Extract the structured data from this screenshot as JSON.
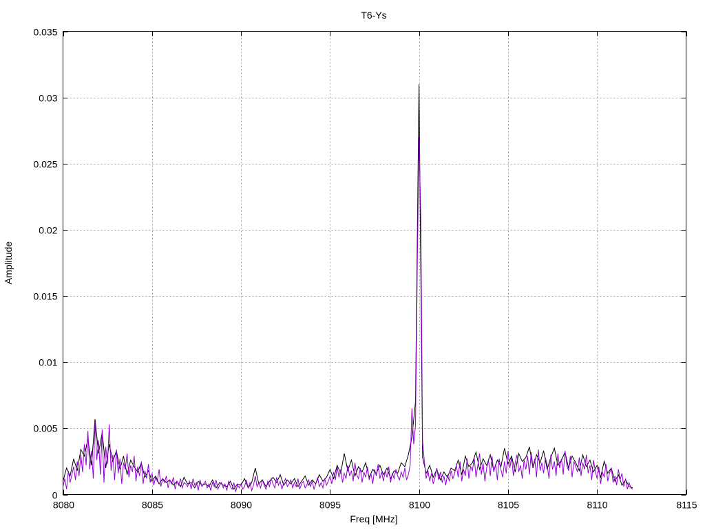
{
  "chart_data": {
    "type": "line",
    "title": "T6-Ys",
    "xlabel": "Freq [MHz]",
    "ylabel": "Amplitude",
    "xlim": [
      8080,
      8115
    ],
    "ylim": [
      0,
      0.035
    ],
    "xticks": [
      "8080",
      "8085",
      "8090",
      "8095",
      "8100",
      "8105",
      "8110",
      "8115"
    ],
    "xtick_values": [
      8080,
      8085,
      8090,
      8095,
      8100,
      8105,
      8110,
      8115
    ],
    "yticks": [
      "0",
      "0.005",
      "0.01",
      "0.015",
      "0.02",
      "0.025",
      "0.03",
      "0.035"
    ],
    "ytick_values": [
      0,
      0.005,
      0.01,
      0.015,
      0.02,
      0.025,
      0.03,
      0.035
    ],
    "grid": true,
    "legend": "none",
    "series": [
      {
        "name": "black",
        "color": "#000000",
        "x_start": 8080,
        "x_step": 0.2,
        "values": [
          0.001,
          0.002,
          0.0014,
          0.0027,
          0.0018,
          0.0034,
          0.0029,
          0.0042,
          0.0022,
          0.0057,
          0.0031,
          0.0047,
          0.002,
          0.0038,
          0.0025,
          0.0033,
          0.0019,
          0.0029,
          0.0015,
          0.0026,
          0.0021,
          0.0017,
          0.0024,
          0.0013,
          0.0018,
          0.001,
          0.0014,
          0.0008,
          0.0012,
          0.0009,
          0.0011,
          0.0007,
          0.001,
          0.0006,
          0.0013,
          0.0008,
          0.0009,
          0.0005,
          0.001,
          0.0007,
          0.0008,
          0.0006,
          0.0011,
          0.0005,
          0.0009,
          0.0007,
          0.0006,
          0.001,
          0.0004,
          0.0008,
          0.0007,
          0.0012,
          0.0005,
          0.0009,
          0.002,
          0.0008,
          0.0011,
          0.0006,
          0.001,
          0.0013,
          0.0009,
          0.0015,
          0.0007,
          0.0011,
          0.0008,
          0.0012,
          0.0006,
          0.001,
          0.0014,
          0.0007,
          0.0011,
          0.0008,
          0.0015,
          0.001,
          0.0013,
          0.0019,
          0.0012,
          0.0022,
          0.0016,
          0.0031,
          0.0018,
          0.0026,
          0.0014,
          0.0021,
          0.0017,
          0.0024,
          0.0013,
          0.0019,
          0.0016,
          0.0022,
          0.0015,
          0.002,
          0.0012,
          0.0018,
          0.0016,
          0.0024,
          0.0021,
          0.003,
          0.0043,
          0.007,
          0.031,
          0.0028,
          0.0016,
          0.0022,
          0.0013,
          0.0019,
          0.0011,
          0.0017,
          0.0013,
          0.002,
          0.0018,
          0.0026,
          0.0015,
          0.0029,
          0.0021,
          0.0024,
          0.0032,
          0.0019,
          0.0027,
          0.0022,
          0.003,
          0.0018,
          0.0026,
          0.0021,
          0.0035,
          0.0023,
          0.0029,
          0.0017,
          0.0031,
          0.0025,
          0.0028,
          0.0036,
          0.002,
          0.003,
          0.0024,
          0.0033,
          0.0019,
          0.0028,
          0.0035,
          0.0022,
          0.0026,
          0.0032,
          0.002,
          0.0029,
          0.0024,
          0.0018,
          0.003,
          0.0021,
          0.0026,
          0.0017,
          0.0022,
          0.0013,
          0.0025,
          0.0016,
          0.002,
          0.001,
          0.0015,
          0.0007,
          0.0011,
          0.0006,
          0.0005
        ]
      },
      {
        "name": "purple",
        "color": "#9400d3",
        "x_start": 8080,
        "x_step": 0.1,
        "values": [
          0.0006,
          0.0012,
          0.0004,
          0.0018,
          0.0009,
          0.0015,
          0.0021,
          0.0011,
          0.0025,
          0.0014,
          0.003,
          0.0017,
          0.0038,
          0.0022,
          0.0048,
          0.0019,
          0.0033,
          0.0012,
          0.0055,
          0.0026,
          0.0041,
          0.0015,
          0.0049,
          0.0009,
          0.0036,
          0.0023,
          0.0053,
          0.0018,
          0.003,
          0.0011,
          0.0034,
          0.0016,
          0.0027,
          0.0008,
          0.0024,
          0.0019,
          0.0031,
          0.0013,
          0.0022,
          0.0017,
          0.0029,
          0.001,
          0.0021,
          0.0014,
          0.0025,
          0.0008,
          0.0018,
          0.0012,
          0.0023,
          0.0009,
          0.0016,
          0.0007,
          0.0013,
          0.001,
          0.0019,
          0.0006,
          0.0012,
          0.0009,
          0.0014,
          0.0005,
          0.0011,
          0.0008,
          0.0013,
          0.0004,
          0.001,
          0.0007,
          0.0012,
          0.0005,
          0.0009,
          0.0008,
          0.0006,
          0.001,
          0.0004,
          0.0012,
          0.0007,
          0.0009,
          0.0003,
          0.0011,
          0.0006,
          0.0008,
          0.001,
          0.0005,
          0.0008,
          0.0003,
          0.0009,
          0.0006,
          0.0011,
          0.0004,
          0.0007,
          0.0009,
          0.0005,
          0.0008,
          0.0003,
          0.001,
          0.0006,
          0.0004,
          0.0009,
          0.0002,
          0.0007,
          0.0005,
          0.0008,
          0.0004,
          0.0006,
          0.0011,
          0.0005,
          0.0009,
          0.0003,
          0.0007,
          0.0014,
          0.0006,
          0.0009,
          0.0005,
          0.0011,
          0.0007,
          0.0004,
          0.001,
          0.0006,
          0.0012,
          0.0008,
          0.0005,
          0.0013,
          0.0007,
          0.001,
          0.0004,
          0.0009,
          0.0012,
          0.0006,
          0.0008,
          0.0011,
          0.0005,
          0.0009,
          0.0006,
          0.0012,
          0.0004,
          0.0008,
          0.001,
          0.0005,
          0.0007,
          0.0011,
          0.0006,
          0.001,
          0.0004,
          0.0008,
          0.0013,
          0.0006,
          0.0009,
          0.0005,
          0.0012,
          0.0007,
          0.001,
          0.0014,
          0.0008,
          0.0017,
          0.0011,
          0.0021,
          0.0013,
          0.0019,
          0.0009,
          0.0016,
          0.0012,
          0.0022,
          0.0014,
          0.0018,
          0.001,
          0.0024,
          0.0015,
          0.0012,
          0.002,
          0.0009,
          0.0017,
          0.0013,
          0.0021,
          0.0011,
          0.0016,
          0.0008,
          0.0019,
          0.0014,
          0.0023,
          0.0012,
          0.0017,
          0.001,
          0.0018,
          0.0013,
          0.0021,
          0.0009,
          0.0016,
          0.0012,
          0.0019,
          0.0014,
          0.0011,
          0.0017,
          0.0013,
          0.002,
          0.0011,
          0.0015,
          0.0022,
          0.0065,
          0.0038,
          0.0052,
          0.017,
          0.027,
          0.021,
          0.004,
          0.0025,
          0.0012,
          0.0018,
          0.001,
          0.0016,
          0.0008,
          0.0013,
          0.002,
          0.0011,
          0.0017,
          0.0009,
          0.0014,
          0.0007,
          0.0015,
          0.001,
          0.0018,
          0.0012,
          0.0016,
          0.0022,
          0.0013,
          0.0025,
          0.001,
          0.0019,
          0.0014,
          0.0027,
          0.0012,
          0.0021,
          0.0018,
          0.0028,
          0.0013,
          0.0022,
          0.0031,
          0.0015,
          0.0024,
          0.001,
          0.002,
          0.0026,
          0.0014,
          0.0029,
          0.0017,
          0.0023,
          0.0011,
          0.0027,
          0.0019,
          0.0013,
          0.0025,
          0.0016,
          0.0033,
          0.002,
          0.0028,
          0.0014,
          0.0024,
          0.003,
          0.0017,
          0.0022,
          0.0012,
          0.0026,
          0.0019,
          0.0029,
          0.0015,
          0.0032,
          0.0021,
          0.0027,
          0.0013,
          0.0034,
          0.0018,
          0.0024,
          0.0016,
          0.0028,
          0.0022,
          0.0012,
          0.003,
          0.0019,
          0.0025,
          0.0014,
          0.0031,
          0.002,
          0.0027,
          0.0015,
          0.0033,
          0.0022,
          0.0018,
          0.0029,
          0.0013,
          0.0025,
          0.0021,
          0.0017,
          0.0028,
          0.0014,
          0.0024,
          0.0019,
          0.003,
          0.0016,
          0.0022,
          0.0011,
          0.0026,
          0.0018,
          0.0012,
          0.0021,
          0.0008,
          0.0017,
          0.0013,
          0.0023,
          0.001,
          0.0016,
          0.002,
          0.0009,
          0.0014,
          0.0007,
          0.0019,
          0.0011,
          0.0016,
          0.0006,
          0.0012,
          0.0004,
          0.0009,
          0.0005,
          0.0004
        ]
      }
    ]
  }
}
